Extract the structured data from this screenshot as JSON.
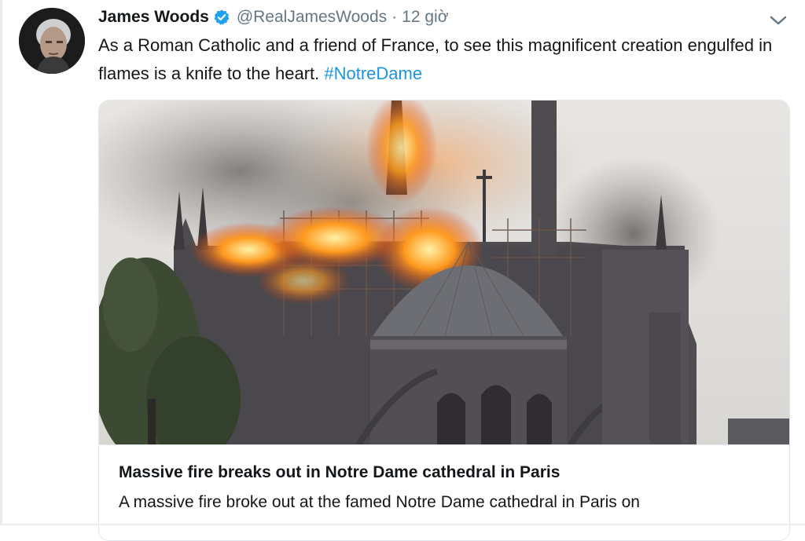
{
  "tweet": {
    "author_name": "James Woods",
    "handle": "@RealJamesWoods",
    "separator": "·",
    "time": "12 giờ",
    "text_before": "As a Roman Catholic and a friend of France, to see this magnificent creation engulfed in flames is a knife to the heart. ",
    "hashtag": "#NotreDame",
    "verified": true,
    "verified_color": "#1da1f2",
    "hashtag_color": "#1b95e0"
  },
  "card": {
    "title": "Massive fire breaks out in Notre Dame cathedral in Paris",
    "description": "A massive fire broke out at the famed Notre Dame cathedral in Paris on"
  },
  "icons": {
    "verified": "verified-badge-icon",
    "menu": "chevron-down-icon"
  }
}
